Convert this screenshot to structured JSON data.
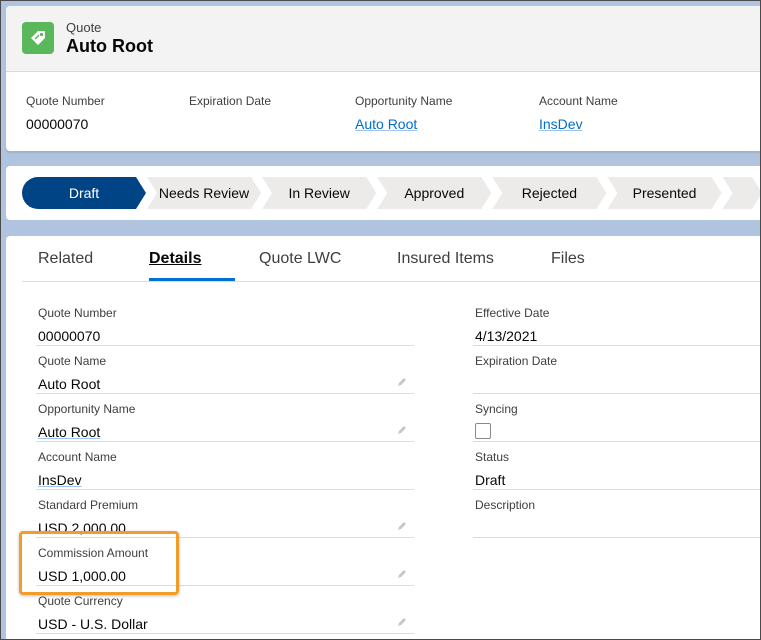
{
  "record": {
    "object_label": "Quote",
    "title": "Auto Root",
    "icon": "quote-tag-icon",
    "icon_color": "#5ab85a"
  },
  "highlights": [
    {
      "label": "Quote Number",
      "value": "00000070"
    },
    {
      "label": "Expiration Date",
      "value": ""
    },
    {
      "label": "Opportunity Name",
      "value": "Auto Root"
    },
    {
      "label": "Account Name",
      "value": "InsDev"
    }
  ],
  "path": {
    "active_color": "#014486",
    "stages": [
      "Draft",
      "Needs Review",
      "In Review",
      "Approved",
      "Rejected",
      "Presented"
    ]
  },
  "tabs": [
    "Related",
    "Details",
    "Quote LWC",
    "Insured Items",
    "Files"
  ],
  "active_tab": "Details",
  "details": {
    "left": [
      {
        "label": "Quote Number",
        "value": "00000070"
      },
      {
        "label": "Quote Name",
        "value": "Auto Root"
      },
      {
        "label": "Opportunity Name",
        "value": "Auto Root"
      },
      {
        "label": "Account Name",
        "value": "InsDev"
      },
      {
        "label": "Standard Premium",
        "value": "USD 2,000.00"
      },
      {
        "label": "Commission Amount",
        "value": "USD 1,000.00"
      },
      {
        "label": "Quote Currency",
        "value": "USD - U.S. Dollar"
      }
    ],
    "right": [
      {
        "label": "Effective Date",
        "value": "4/13/2021"
      },
      {
        "label": "Expiration Date",
        "value": ""
      },
      {
        "label": "Syncing",
        "value": false
      },
      {
        "label": "Status",
        "value": "Draft"
      },
      {
        "label": "Description",
        "value": ""
      }
    ]
  },
  "highlight_color": "#f29d2a"
}
